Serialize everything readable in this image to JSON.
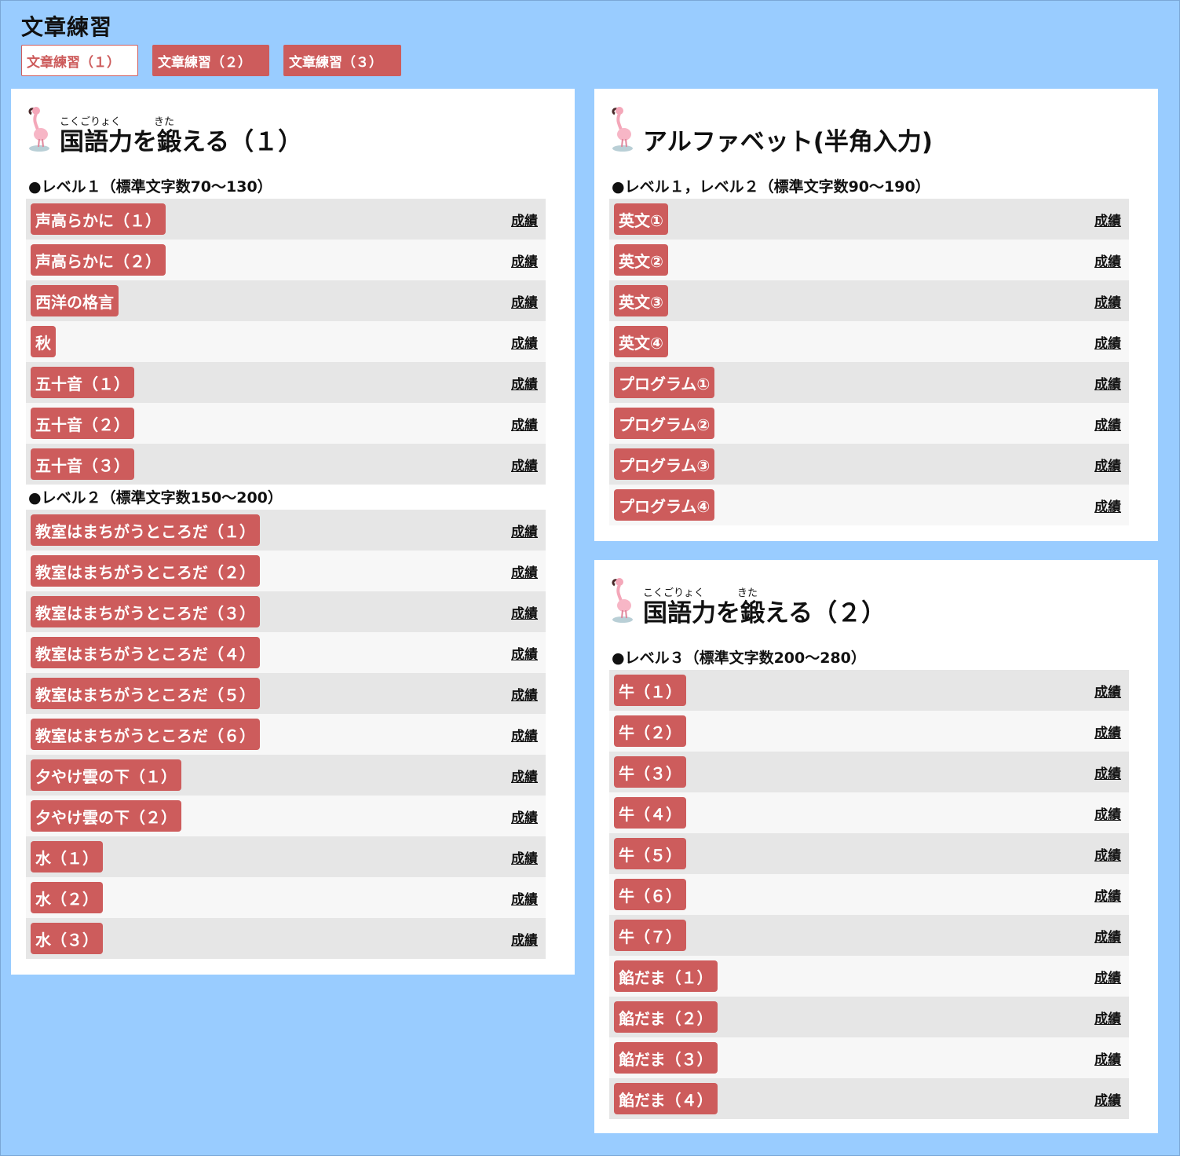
{
  "page": {
    "title": "文章練習"
  },
  "tabs": [
    {
      "label": "文章練習（１）",
      "active": true
    },
    {
      "label": "文章練習（２）",
      "active": false
    },
    {
      "label": "文章練習（３）",
      "active": false
    }
  ],
  "score_label": "成績",
  "colors": {
    "background": "#99ccff",
    "accent": "#cd5c5c",
    "row_dark": "#e6e6e6",
    "row_light": "#f7f7f7"
  },
  "panels": {
    "kokugo1": {
      "title": "国語力を鍛える（１）",
      "ruby_kokugoryoku": "こくごりょく",
      "ruby_kitaeru": "きた",
      "level1": {
        "heading": "●レベル１（標準文字数70～130）",
        "items": [
          "声高らかに（１）",
          "声高らかに（２）",
          "西洋の格言",
          "秋",
          "五十音（１）",
          "五十音（２）",
          "五十音（３）"
        ]
      },
      "level2": {
        "heading": "●レベル２（標準文字数150～200）",
        "items": [
          "教室はまちがうところだ（１）",
          "教室はまちがうところだ（２）",
          "教室はまちがうところだ（３）",
          "教室はまちがうところだ（４）",
          "教室はまちがうところだ（５）",
          "教室はまちがうところだ（６）",
          "夕やけ雲の下（１）",
          "夕やけ雲の下（２）",
          "水（１）",
          "水（２）",
          "水（３）"
        ]
      }
    },
    "alphabet": {
      "title": "アルファベット(半角入力)",
      "level": {
        "heading": "●レベル１，レベル２（標準文字数90～190）",
        "items": [
          "英文①",
          "英文②",
          "英文③",
          "英文④",
          "プログラム①",
          "プログラム②",
          "プログラム③",
          "プログラム④"
        ]
      }
    },
    "kokugo2": {
      "title": "国語力を鍛える（２）",
      "ruby_kokugoryoku": "こくごりょく",
      "ruby_kitaeru": "きた",
      "level3": {
        "heading": "●レベル３（標準文字数200～280）",
        "items": [
          "牛（１）",
          "牛（２）",
          "牛（３）",
          "牛（４）",
          "牛（５）",
          "牛（６）",
          "牛（７）",
          "餡だま（１）",
          "餡だま（２）",
          "餡だま（３）",
          "餡だま（４）"
        ]
      }
    }
  }
}
